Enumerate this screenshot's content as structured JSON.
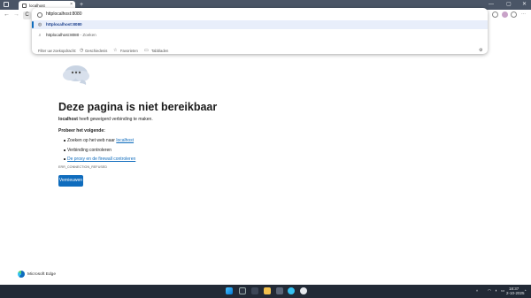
{
  "browser": {
    "tab_title": "localhost",
    "tab_close": "×",
    "new_tab": "+",
    "window_controls": [
      "—",
      "▢",
      "✕"
    ]
  },
  "toolbar": {
    "back": "←",
    "forward": "→",
    "reload": "C"
  },
  "omnibox": {
    "value": "httplocalhost:8080",
    "suggestions": [
      {
        "text": "httplocalhost:8080",
        "suffix": ""
      },
      {
        "text": "httplocalhost:8080",
        "suffix": " - Zoeken"
      }
    ],
    "filter_label": "Filter uw zoekopdracht:",
    "filters": [
      "Geschiedenis",
      "Favorieten",
      "Tabbladen"
    ]
  },
  "error_page": {
    "title": "Deze pagina is niet bereikbaar",
    "host": "localhost",
    "message": " heeft geweigerd verbinding te maken.",
    "try_heading": "Probeer het volgende:",
    "suggestions": [
      {
        "prefix": "Zoeken op het web naar ",
        "link": "localhost"
      },
      {
        "prefix": "Verbinding controleren",
        "link": ""
      },
      {
        "prefix": "",
        "link": "De proxy en de firewall controleren"
      }
    ],
    "error_code": "ERR_CONNECTION_REFUSED",
    "refresh_button": "Vernieuwen"
  },
  "brand": {
    "name": "Microsoft Edge"
  },
  "taskbar": {
    "time": "18:37",
    "date": "2-10-2025",
    "tray_chevron": "^"
  },
  "colors": {
    "accent": "#0f6cbd",
    "taskbar": "#222a36",
    "tabstrip": "#4a5566"
  }
}
